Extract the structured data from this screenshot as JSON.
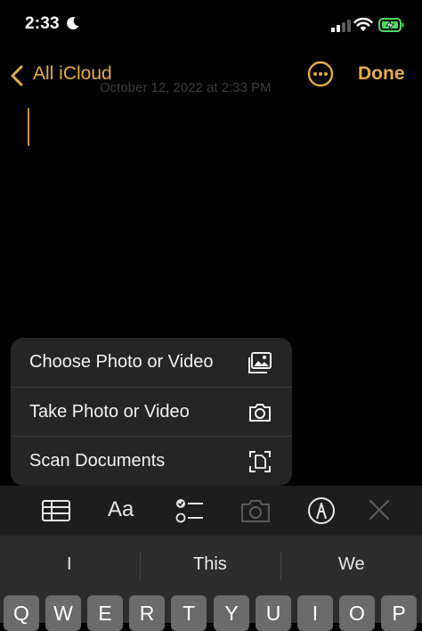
{
  "status_bar": {
    "time": "2:33",
    "icons": [
      "moon-icon",
      "cellular-signal-icon",
      "wifi-icon",
      "battery-charging-icon"
    ]
  },
  "nav": {
    "back_label": "All iCloud",
    "done_label": "Done",
    "more_icon": "ellipsis-circle-icon",
    "accent_color": "#e7ad3d"
  },
  "note": {
    "date_text": "October 12, 2022 at 2:33 PM"
  },
  "menu": {
    "items": [
      {
        "label": "Choose Photo or Video",
        "icon": "photo-library-icon"
      },
      {
        "label": "Take Photo or Video",
        "icon": "camera-icon"
      },
      {
        "label": "Scan Documents",
        "icon": "document-scan-icon"
      }
    ]
  },
  "toolbar": {
    "items": [
      "table-icon",
      "text-format-icon",
      "checklist-icon",
      "camera-icon",
      "markup-pen-icon",
      "close-icon"
    ],
    "format_label": "Aa"
  },
  "keyboard": {
    "suggestions": [
      "I",
      "This",
      "We"
    ],
    "keys_row1": [
      "Q",
      "W",
      "E",
      "R",
      "T",
      "Y",
      "U",
      "I",
      "O",
      "P"
    ]
  }
}
